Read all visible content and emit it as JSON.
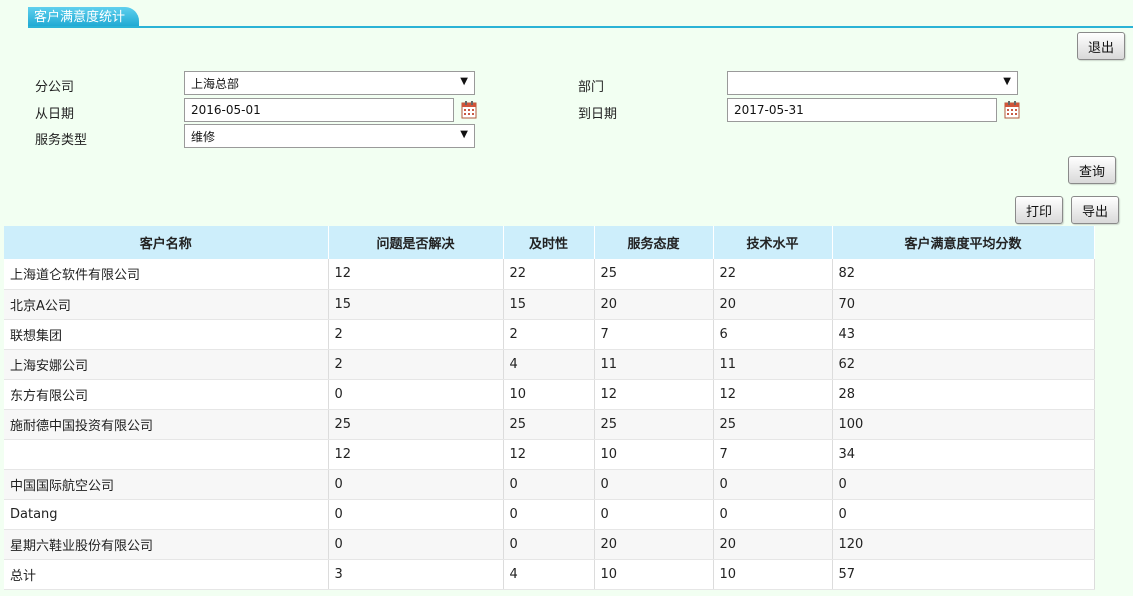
{
  "tab": {
    "title": "客户满意度统计"
  },
  "buttons": {
    "exit": "退出",
    "query": "查询",
    "print": "打印",
    "export": "导出"
  },
  "filters": {
    "branch_label": "分公司",
    "branch_value": "上海总部",
    "dept_label": "部门",
    "dept_value": "",
    "from_label": "从日期",
    "from_value": "2016-05-01",
    "to_label": "到日期",
    "to_value": "2017-05-31",
    "service_label": "服务类型",
    "service_value": "维修"
  },
  "table": {
    "headers": [
      "客户名称",
      "问题是否解决",
      "及时性",
      "服务态度",
      "技术水平",
      "客户满意度平均分数"
    ],
    "rows": [
      [
        "上海道仑软件有限公司",
        "12",
        "22",
        "25",
        "22",
        "82"
      ],
      [
        "北京A公司",
        "15",
        "15",
        "20",
        "20",
        "70"
      ],
      [
        "联想集团",
        "2",
        "2",
        "7",
        "6",
        "43"
      ],
      [
        "上海安娜公司",
        "2",
        "4",
        "11",
        "11",
        "62"
      ],
      [
        "东方有限公司",
        "0",
        "10",
        "12",
        "12",
        "28"
      ],
      [
        "施耐德中国投资有限公司",
        "25",
        "25",
        "25",
        "25",
        "100"
      ],
      [
        "",
        "12",
        "12",
        "10",
        "7",
        "34"
      ],
      [
        "中国国际航空公司",
        "0",
        "0",
        "0",
        "0",
        "0"
      ],
      [
        "Datang",
        "0",
        "0",
        "0",
        "0",
        "0"
      ],
      [
        "星期六鞋业股份有限公司",
        "0",
        "0",
        "20",
        "20",
        "120"
      ],
      [
        "总计",
        "3",
        "4",
        "10",
        "10",
        "57"
      ]
    ]
  },
  "icons": {
    "calendar": "calendar-icon",
    "dropdown": "chevron-down-icon"
  },
  "colors": {
    "tab_accent": "#1aa6d1",
    "header_bg": "#cdeefb",
    "page_bg": "#f2fff2"
  }
}
